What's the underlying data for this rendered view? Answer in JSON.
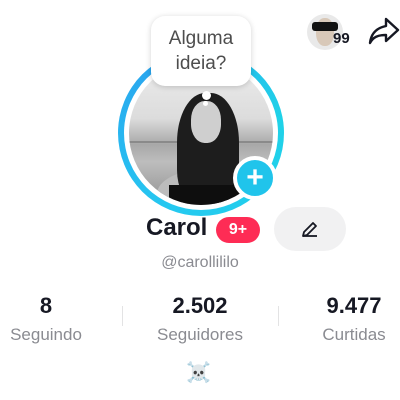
{
  "bubble": {
    "line1": "Alguma",
    "line2": "ideia?"
  },
  "friends": {
    "count": "99"
  },
  "profile": {
    "name": "Carol",
    "badge": "9+",
    "username": "@carollilil o",
    "bio_emoji": "☠️"
  },
  "stats": [
    {
      "value": "8",
      "label": "Seguindo"
    },
    {
      "value": "2.502",
      "label": "Seguidores"
    },
    {
      "value": "9.477",
      "label": "Curtidas"
    }
  ],
  "icons": {
    "add": "plus-icon",
    "edit": "pencil-icon",
    "share": "share-arrow-icon"
  },
  "colors": {
    "ring": "#25c9f0",
    "badge": "#fe2c55",
    "add_button": "#20c4eb",
    "muted_text": "#8a8b91"
  }
}
